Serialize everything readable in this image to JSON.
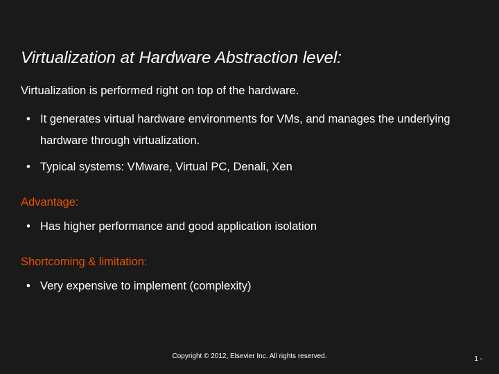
{
  "title": "Virtualization at Hardware Abstraction level:",
  "subtitle": "Virtualization is performed right on top of the hardware.",
  "bullets_main": [
    "It generates virtual hardware environments for VMs, and manages the underlying hardware through virtualization.",
    "Typical systems: VMware, Virtual PC, Denali, Xen"
  ],
  "advantage_label": "Advantage:",
  "bullets_advantage": [
    "Has higher performance and good application isolation"
  ],
  "limitation_label": "Shortcoming & limitation:",
  "bullets_limitation": [
    "Very expensive to implement (complexity)"
  ],
  "footer": "Copyright © 2012, Elsevier Inc. All rights reserved.",
  "pagenum": "1 -"
}
